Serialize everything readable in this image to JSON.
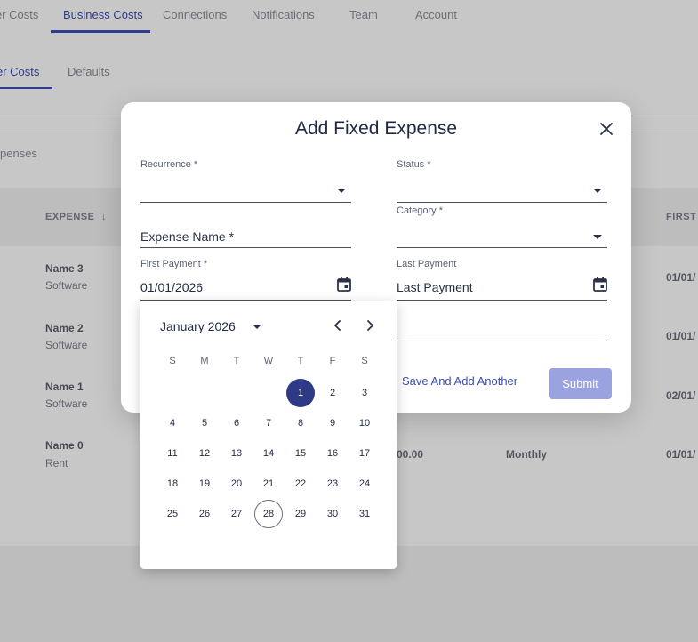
{
  "background": {
    "tabs": [
      {
        "label": "er Costs",
        "active": false
      },
      {
        "label": "Business Costs",
        "active": true
      },
      {
        "label": "Connections",
        "active": false
      },
      {
        "label": "Notifications",
        "active": false
      },
      {
        "label": "Team",
        "active": false
      },
      {
        "label": "Account",
        "active": false
      }
    ],
    "subtabs": [
      {
        "label": "er Costs",
        "active": true
      },
      {
        "label": "Defaults",
        "active": false
      }
    ],
    "search_text": "penses",
    "table": {
      "headers": [
        "EXPENSE",
        "FIRST I"
      ],
      "sort_icon": "arrow-down-icon",
      "rows": [
        {
          "name": "Name 3",
          "category": "Software",
          "first": "01/01/"
        },
        {
          "name": "Name 2",
          "category": "Software",
          "first": "01/01/"
        },
        {
          "name": "Name 1",
          "category": "Software",
          "first": "02/01/"
        },
        {
          "name": "Name 0",
          "category": "Rent",
          "amount": "00.00",
          "recurrence": "Monthly",
          "first": "01/01/"
        }
      ]
    }
  },
  "dialog": {
    "title": "Add Fixed Expense",
    "close_icon": "close-icon",
    "fields": {
      "recurrence": {
        "label": "Recurrence *",
        "value": ""
      },
      "status": {
        "label": "Status *",
        "value": ""
      },
      "category": {
        "label": "Category *",
        "value": ""
      },
      "expense_name": {
        "placeholder": "Expense Name *"
      },
      "first_payment": {
        "label": "First Payment *",
        "value": "01/01/2026",
        "icon": "calendar-icon"
      },
      "last_payment": {
        "label": "Last Payment",
        "placeholder": "Last Payment",
        "icon": "calendar-icon"
      }
    },
    "buttons": {
      "save_add_another": "Save And Add Another",
      "submit": "Submit"
    }
  },
  "date_picker": {
    "month_label": "January 2026",
    "weekdays": [
      "S",
      "M",
      "T",
      "W",
      "T",
      "F",
      "S"
    ],
    "first_weekday_index": 4,
    "days_in_month": 31,
    "selected_day": 1,
    "today_day": 28,
    "prev_icon": "chevron-left-icon",
    "next_icon": "chevron-right-icon"
  },
  "colors": {
    "accent": "#3b4fb3",
    "selected_day": "#2e3a86",
    "submit_disabled": "#9aa3e0"
  }
}
